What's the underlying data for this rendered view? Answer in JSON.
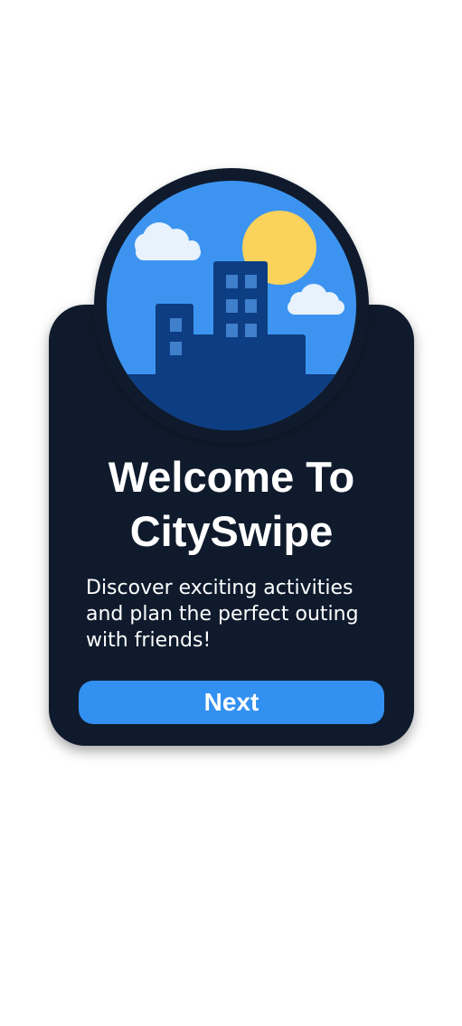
{
  "welcome": {
    "title": "Welcome To CitySwipe",
    "description": "Discover exciting activities and plan the perfect outing with friends!",
    "next_label": "Next"
  },
  "colors": {
    "background": "#ffffff",
    "card": "#0f1b2d",
    "button": "#3290f1",
    "sky": "#3d94f0",
    "sun": "#fbd25c",
    "cloud": "#e8f2fd",
    "buildings": "#0d3d82",
    "windows": "#3f7fcc"
  },
  "icons": {
    "hero": "city-skyline-illustration"
  }
}
